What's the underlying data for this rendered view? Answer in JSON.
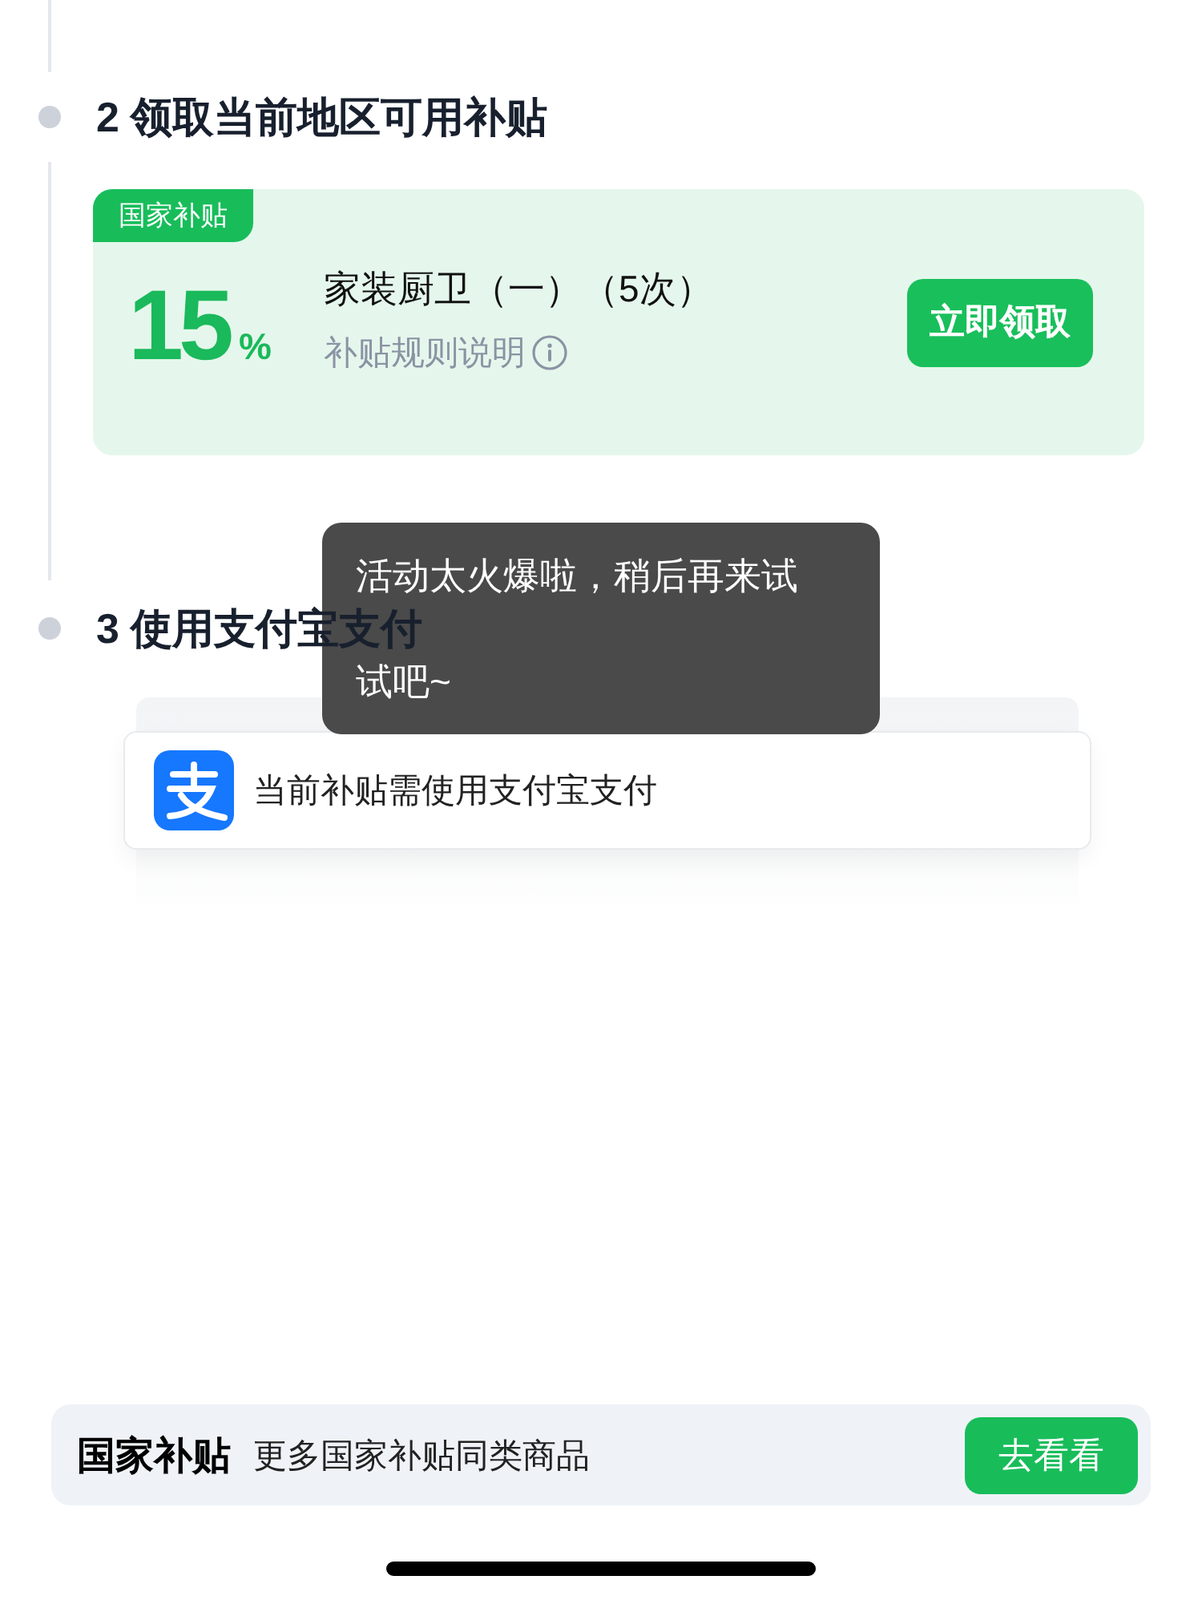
{
  "timeline": {
    "steps": [
      {
        "kind": "subsidy",
        "title": "2 领取当前地区可用补贴",
        "card": {
          "tag": "国家补贴",
          "rate": "15",
          "unit": "%",
          "title": "家装厨卫（一）（5次）",
          "rules_link": "补贴规则说明",
          "button": "立即领取"
        }
      },
      {
        "kind": "payment",
        "title": "3 使用支付宝支付",
        "notice": {
          "text": "当前补贴需使用支付宝支付"
        }
      }
    ]
  },
  "toast": {
    "message": "活动太火爆啦，稍后再来试试吧~"
  },
  "bottom_banner": {
    "brand": "国家补贴",
    "text": "更多国家补贴同类商品",
    "button": "去看看"
  }
}
